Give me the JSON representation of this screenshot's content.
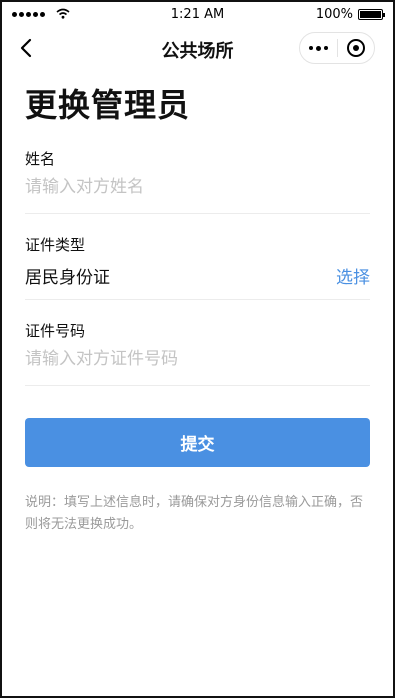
{
  "status_bar": {
    "time": "1:21 AM",
    "battery": "100%"
  },
  "nav": {
    "title": "公共场所",
    "back_icon": "chevron-left-icon",
    "more_icon": "more-dots-icon",
    "close_icon": "target-circle-icon"
  },
  "page": {
    "title": "更换管理员"
  },
  "form": {
    "name": {
      "label": "姓名",
      "value": "",
      "placeholder": "请输入对方姓名"
    },
    "id_type": {
      "label": "证件类型",
      "value": "居民身份证",
      "action": "选择"
    },
    "id_number": {
      "label": "证件号码",
      "value": "",
      "placeholder": "请输入对方证件号码"
    }
  },
  "submit_label": "提交",
  "note": "说明：填写上述信息时，请确保对方身份信息输入正确，否则将无法更换成功。",
  "colors": {
    "accent": "#4a90e2",
    "placeholder": "#c4c4c4",
    "note_text": "#9a9a9a"
  }
}
